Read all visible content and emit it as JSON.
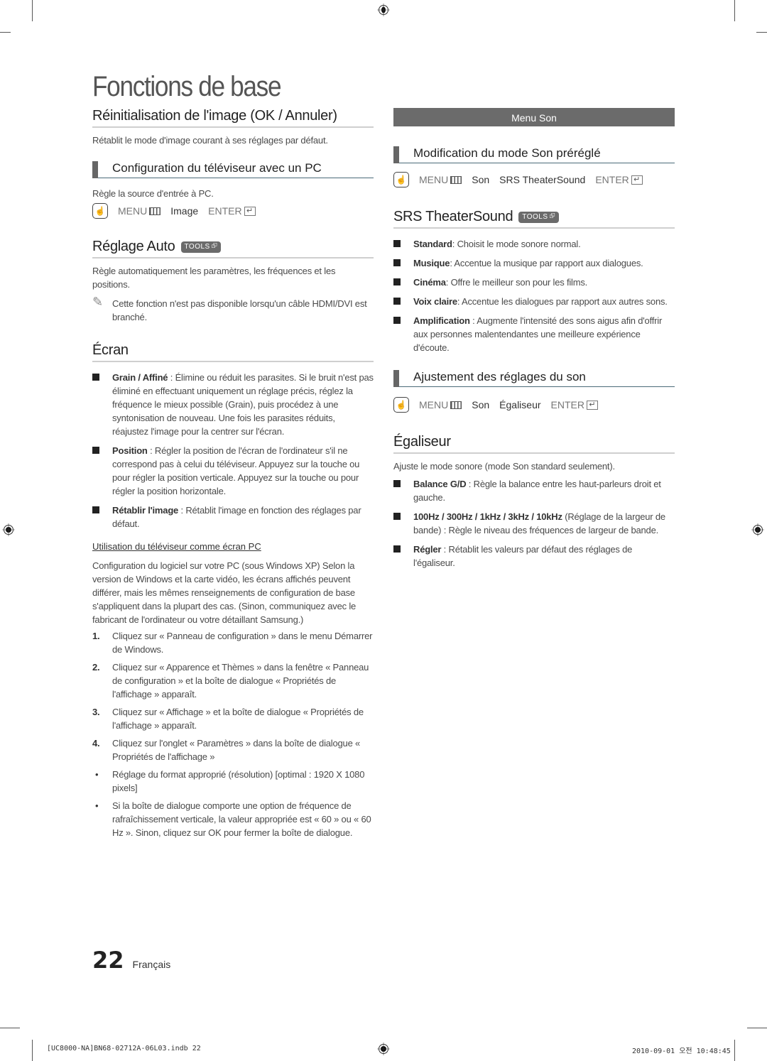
{
  "page_title": "Fonctions de base",
  "left": {
    "reset": {
      "title": "Réinitialisation de l'image (OK / Annuler)",
      "desc": "Rétablit le mode d'image courant à ses réglages par défaut."
    },
    "pc_config": {
      "title": "Configuration du téléviseur avec un PC",
      "desc": "Règle la source d'entrée à PC.",
      "menu_path": {
        "menu": "MENU",
        "step1": "Image",
        "enter": "ENTER"
      }
    },
    "auto": {
      "title": "Réglage Auto",
      "badge": "TOOLS",
      "desc": "Règle automatiquement les paramètres, les fréquences et les positions.",
      "note": "Cette fonction n'est pas disponible lorsqu'un câble HDMI/DVI est branché."
    },
    "ecran": {
      "title": "Écran",
      "items": [
        {
          "term": "Grain / Affiné",
          "text": " : Élimine ou réduit les parasites. Si le bruit n'est pas éliminé en effectuant uniquement un réglage précis, réglez la fréquence le mieux possible (Grain), puis procédez à une syntonisation de nouveau. Une fois les parasites réduits, réajustez l'image pour la centrer sur l'écran."
        },
        {
          "term": "Position",
          "text": " : Régler la position de l'écran de l'ordinateur s'il ne correspond pas à celui du téléviseur. Appuyez sur la touche ou pour régler la position verticale. Appuyez sur la touche ou pour régler la position horizontale."
        },
        {
          "term": "Rétablir l'image",
          "text": " : Rétablit l'image en fonction des réglages par défaut."
        }
      ]
    },
    "pc_use": {
      "subtitle": "Utilisation du téléviseur comme écran PC",
      "intro": "Configuration du logiciel sur votre PC (sous Windows XP) Selon la version de Windows et la carte vidéo, les écrans affichés peuvent différer, mais les mêmes renseignements de configuration de base s'appliquent dans la plupart des cas. (Sinon, communiquez avec le fabricant de l'ordinateur ou votre détaillant Samsung.)",
      "steps": [
        {
          "n": "1.",
          "text": "Cliquez sur « Panneau de configuration » dans le menu Démarrer de Windows."
        },
        {
          "n": "2.",
          "text": "Cliquez sur « Apparence et Thèmes » dans la fenêtre « Panneau de configuration » et la boîte de dialogue « Propriétés de l'affichage » apparaît."
        },
        {
          "n": "3.",
          "text": "Cliquez sur « Affichage » et la boîte de dialogue « Propriétés de l'affichage » apparaît."
        },
        {
          "n": "4.",
          "text": "Cliquez sur l'onglet « Paramètres » dans la boîte de dialogue « Propriétés de l'affichage »"
        }
      ],
      "bullets": [
        {
          "n": "•",
          "text": "Réglage du format approprié (résolution) [optimal : 1920 X 1080 pixels]"
        },
        {
          "n": "•",
          "text": "Si la boîte de dialogue comporte une option de fréquence de rafraîchissement verticale, la valeur appropriée est « 60 » ou « 60 Hz ». Sinon, cliquez sur OK pour fermer la boîte de dialogue."
        }
      ]
    }
  },
  "right": {
    "menu_bar": "Menu Son",
    "preset": {
      "title": "Modification du mode Son préréglé",
      "menu_path": {
        "menu": "MENU",
        "step1": "Son",
        "step2": "SRS TheaterSound",
        "enter": "ENTER"
      }
    },
    "srs": {
      "title": "SRS TheaterSound",
      "badge": "TOOLS",
      "items": [
        {
          "term": "Standard",
          "text": ": Choisit le mode sonore normal."
        },
        {
          "term": "Musique",
          "text": ": Accentue la musique par rapport aux dialogues."
        },
        {
          "term": "Cinéma",
          "text": ": Offre le meilleur son pour les films."
        },
        {
          "term": "Voix claire",
          "text": ": Accentue les dialogues par rapport aux autres sons."
        },
        {
          "term": "Amplification",
          "text": " : Augmente l'intensité des sons aigus afin d'offrir aux personnes malentendantes une meilleure expérience d'écoute."
        }
      ]
    },
    "adjust": {
      "title": "Ajustement des réglages du son",
      "menu_path": {
        "menu": "MENU",
        "step1": "Son",
        "step2": "Égaliseur",
        "enter": "ENTER"
      }
    },
    "eq": {
      "title": "Égaliseur",
      "desc": "Ajuste le mode sonore (mode Son standard seulement).",
      "items": [
        {
          "term": "Balance G/D",
          "text": " : Règle la balance entre les haut-parleurs droit et gauche."
        },
        {
          "term": "100Hz / 300Hz / 1kHz / 3kHz / 10kHz",
          "text": " (Réglage de la largeur de bande) : Règle le niveau des fréquences de largeur de bande."
        },
        {
          "term": "Régler",
          "text": " : Rétablit les valeurs par défaut des réglages de l'égaliseur."
        }
      ]
    }
  },
  "footer": {
    "page_number": "22",
    "language": "Français",
    "slug_left": "[UC8000-NA]BN68-02712A-06L03.indb   22",
    "slug_right": "2010-09-01   오전 10:48:45"
  }
}
